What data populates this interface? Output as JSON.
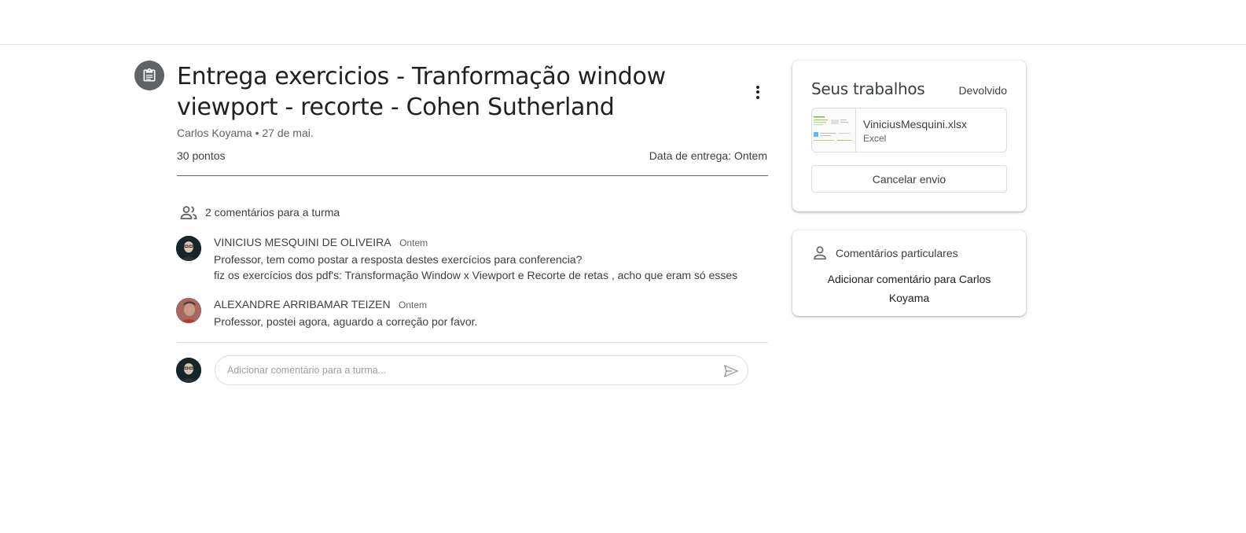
{
  "assignment": {
    "title": "Entrega exercicios - Tranformação window viewport - recorte - Cohen Sutherland",
    "meta": "Carlos Koyama • 27 de mai.",
    "points": "30 pontos",
    "due": "Data de entrega: Ontem"
  },
  "class_comments": {
    "header": "2 comentários para a turma",
    "items": [
      {
        "author": "VINICIUS MESQUINI DE OLIVEIRA",
        "time": "Ontem",
        "line1": "Professor, tem como postar a resposta destes exercícios para conferencia?",
        "line2": "fiz os exercícios dos pdf's: Transformação Window x Viewport e Recorte de retas , acho que eram só esses"
      },
      {
        "author": "ALEXANDRE ARRIBAMAR TEIZEN",
        "time": "Ontem",
        "line1": "Professor, postei agora, aguardo a correção por favor."
      }
    ],
    "input_placeholder": "Adicionar comentário para a turma..."
  },
  "your_work": {
    "title": "Seus trabalhos",
    "status": "Devolvido",
    "attachment": {
      "name": "ViniciusMesquini.xlsx",
      "type": "Excel"
    },
    "cancel_label": "Cancelar envio"
  },
  "private_comments": {
    "header": "Comentários particulares",
    "add_label": "Adicionar comentário para Carlos Koyama"
  },
  "icons": {
    "assignment": "assignment-icon",
    "more": "more-vert-icon",
    "people": "people-icon",
    "person": "person-icon",
    "send": "send-icon"
  },
  "colors": {
    "icon_circle": "#5f6368",
    "text": "#3c4043",
    "border": "#dadce0"
  }
}
